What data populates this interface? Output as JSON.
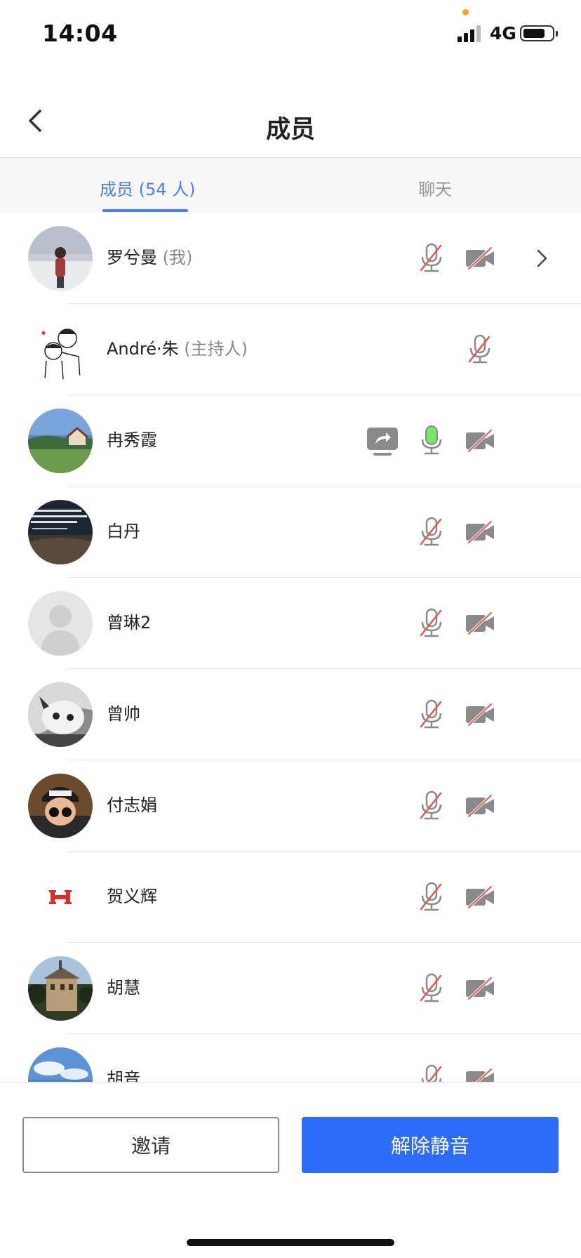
{
  "status_bar": {
    "time": "14:04",
    "network": "4G"
  },
  "header": {
    "title": "成员",
    "back_icon": "chevron-left-icon"
  },
  "tabs": [
    {
      "label": "成员 (54 人)",
      "active": true
    },
    {
      "label": "聊天",
      "active": false
    }
  ],
  "colors": {
    "accent": "#4c7ef3",
    "primary_button": "#2d6cf6",
    "muted_red": "#e05a4f",
    "mic_active": "#7be36a",
    "icon_gray": "#8a8a8a"
  },
  "members": [
    {
      "name": "罗兮曼",
      "role": "(我)",
      "avatar": "photo-woman-snow",
      "mic": "muted",
      "camera": "off",
      "sharing": false,
      "has_detail": true
    },
    {
      "name": "André·朱",
      "role": "(主持人)",
      "avatar": "sketch-couple",
      "mic": "muted",
      "camera": "none",
      "sharing": false,
      "has_detail": false
    },
    {
      "name": "冉秀霞",
      "role": "",
      "avatar": "photo-landscape-house",
      "mic": "active",
      "camera": "off",
      "sharing": true,
      "has_detail": false
    },
    {
      "name": "白丹",
      "role": "",
      "avatar": "photo-dark-text",
      "mic": "muted",
      "camera": "off",
      "sharing": false,
      "has_detail": false
    },
    {
      "name": "曾琳2",
      "role": "",
      "avatar": "default-silhouette",
      "mic": "muted",
      "camera": "off",
      "sharing": false,
      "has_detail": false
    },
    {
      "name": "曾帅",
      "role": "",
      "avatar": "photo-cat-bw",
      "mic": "muted",
      "camera": "off",
      "sharing": false,
      "has_detail": false
    },
    {
      "name": "付志娟",
      "role": "",
      "avatar": "photo-child-glasses",
      "mic": "muted",
      "camera": "off",
      "sharing": false,
      "has_detail": false
    },
    {
      "name": "贺义辉",
      "role": "",
      "avatar": "logo-red-h",
      "mic": "muted",
      "camera": "off",
      "sharing": false,
      "has_detail": false
    },
    {
      "name": "胡慧",
      "role": "",
      "avatar": "photo-building",
      "mic": "muted",
      "camera": "off",
      "sharing": false,
      "has_detail": false
    },
    {
      "name": "胡音",
      "role": "",
      "avatar": "photo-sky-clouds",
      "mic": "muted",
      "camera": "off",
      "sharing": false,
      "has_detail": false
    }
  ],
  "actions": {
    "invite_label": "邀请",
    "unmute_label": "解除静音"
  }
}
